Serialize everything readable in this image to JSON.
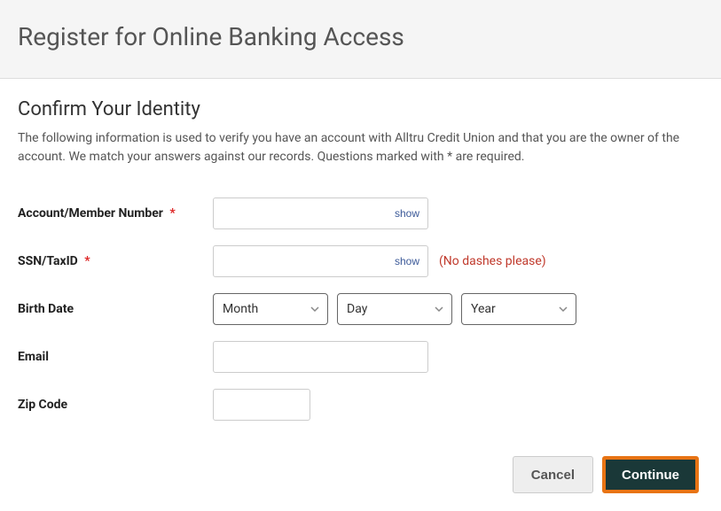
{
  "header": {
    "title": "Register for Online Banking Access"
  },
  "section": {
    "title": "Confirm Your Identity",
    "description": "The following information is used to verify you have an account with Alltru Credit Union and that you are the owner of the account. We match your answers against our records. Questions marked with * are required."
  },
  "required_mark": "*",
  "fields": {
    "account": {
      "label": "Account/Member Number",
      "show": "show"
    },
    "ssn": {
      "label": "SSN/TaxID",
      "show": "show",
      "hint": "(No dashes please)"
    },
    "birthdate": {
      "label": "Birth Date",
      "month": "Month",
      "day": "Day",
      "year": "Year"
    },
    "email": {
      "label": "Email"
    },
    "zip": {
      "label": "Zip Code"
    }
  },
  "buttons": {
    "cancel": "Cancel",
    "continue": "Continue"
  }
}
